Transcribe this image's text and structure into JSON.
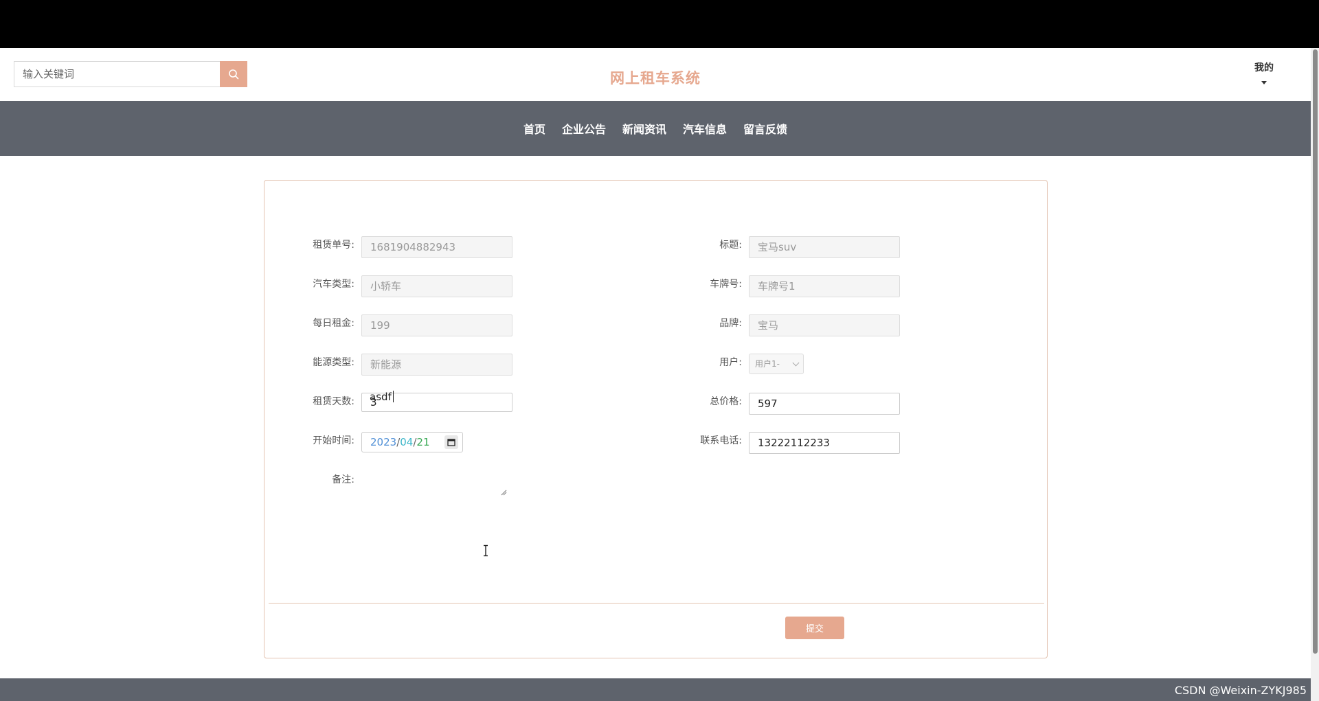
{
  "header": {
    "search_placeholder": "输入关键词",
    "site_title": "网上租车系统",
    "user_menu_label": "我的"
  },
  "nav": {
    "items": [
      "首页",
      "企业公告",
      "新闻资讯",
      "汽车信息",
      "留言反馈"
    ]
  },
  "form": {
    "order_no": {
      "label": "租赁单号:",
      "value": "1681904882943"
    },
    "title": {
      "label": "标题:",
      "value": "宝马suv"
    },
    "car_type": {
      "label": "汽车类型:",
      "value": "小轿车"
    },
    "plate_no": {
      "label": "车牌号:",
      "value": "车牌号1"
    },
    "daily_rent": {
      "label": "每日租金:",
      "value": "199"
    },
    "brand": {
      "label": "品牌:",
      "value": "宝马"
    },
    "energy_type": {
      "label": "能源类型:",
      "value": "新能源"
    },
    "user": {
      "label": "用户:",
      "value": "用户1-"
    },
    "rent_days": {
      "label": "租赁天数:",
      "value": "3"
    },
    "total_price": {
      "label": "总价格:",
      "value": "597"
    },
    "start_time": {
      "label": "开始时间:",
      "year": "2023",
      "month": "04",
      "day": "21",
      "sep": "/"
    },
    "phone": {
      "label": "联系电话:",
      "value": "13222112233"
    },
    "remark": {
      "label": "备注:",
      "value": "asdf"
    },
    "submit_label": "提交"
  },
  "watermark": "CSDN @Weixin-ZYKJ985",
  "colors": {
    "accent": "#e6a88f",
    "nav_bg": "#5e636c",
    "panel_border": "#e3c3b1"
  }
}
